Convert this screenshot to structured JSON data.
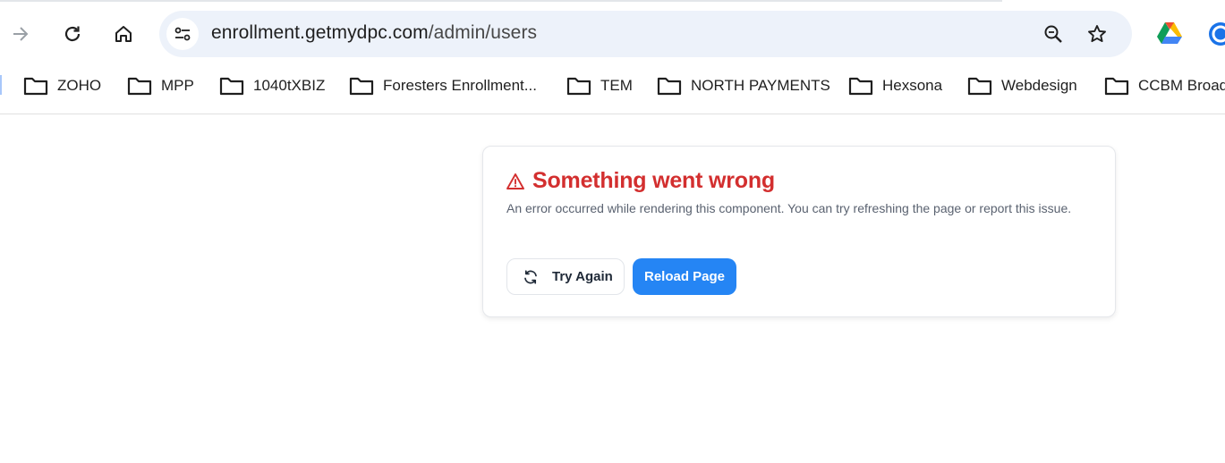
{
  "browser": {
    "url_host": "enrollment.getmydpc.com",
    "url_path": "/admin/users"
  },
  "bookmarks": [
    {
      "label": "ZOHO"
    },
    {
      "label": "MPP"
    },
    {
      "label": "1040tXBIZ"
    },
    {
      "label": "Foresters Enrollment..."
    },
    {
      "label": "TEM"
    },
    {
      "label": "NORTH PAYMENTS"
    },
    {
      "label": "Hexsona"
    },
    {
      "label": "Webdesign"
    },
    {
      "label": "CCBM Broad"
    }
  ],
  "error": {
    "title": "Something went wrong",
    "description": "An error occurred while rendering this component. You can try refreshing the page or report this issue.",
    "try_again_label": "Try Again",
    "reload_label": "Reload Page"
  },
  "colors": {
    "error_red": "#d32f2f",
    "primary_blue": "#2585f4",
    "omnibox_bg": "#edf2fa"
  },
  "icons": [
    "forward-arrow-icon",
    "reload-icon",
    "home-icon",
    "site-info-icon",
    "zoom-icon",
    "star-icon",
    "google-drive-icon",
    "extension-icon",
    "folder-icon",
    "warning-icon",
    "refresh-icon"
  ]
}
